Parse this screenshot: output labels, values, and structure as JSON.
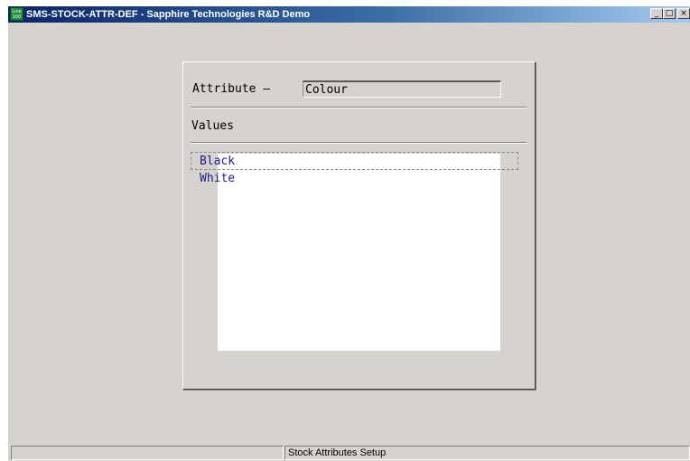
{
  "window": {
    "title": "SMS-STOCK-ATTR-DEF - Sapphire Technologies R&D Demo",
    "app_icon_text": "Line 100",
    "minimize_glyph": "_",
    "maximize_glyph": "□",
    "close_glyph": "×"
  },
  "form": {
    "attribute_label": "Attribute —",
    "attribute_value": "Colour",
    "values_label": "Values",
    "values": [
      "Black",
      "White"
    ]
  },
  "statusbar": {
    "left_text": "",
    "center_text": "Stock Attributes Setup"
  }
}
